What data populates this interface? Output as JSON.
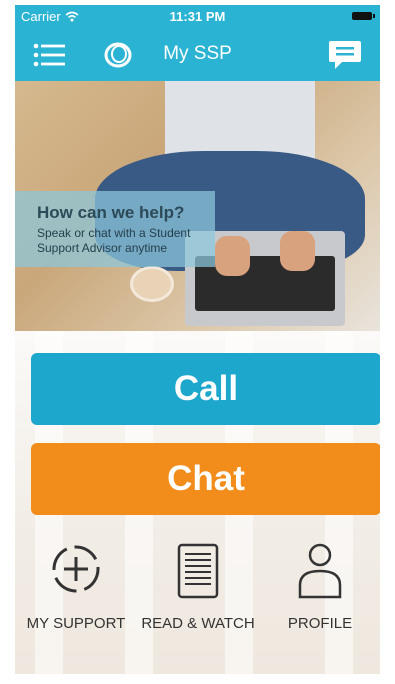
{
  "status": {
    "carrier": "Carrier",
    "time": "11:31 PM"
  },
  "nav": {
    "title": "My SSP",
    "menu_icon": "menu-icon",
    "logo_icon": "logo-ring-icon",
    "chat_icon": "chat-bubble-icon"
  },
  "hero": {
    "heading": "How can we help?",
    "subtext": "Speak or chat with a Student Support Advisor anytime"
  },
  "actions": {
    "call_label": "Call",
    "chat_label": "Chat"
  },
  "tabs": [
    {
      "label": "MY SUPPORT",
      "icon": "plus-circle-icon"
    },
    {
      "label": "READ & WATCH",
      "icon": "document-icon"
    },
    {
      "label": "PROFILE",
      "icon": "profile-icon"
    }
  ],
  "colors": {
    "nav": "#2bb3d3",
    "call": "#1ea7cd",
    "chat": "#f28c1a"
  }
}
